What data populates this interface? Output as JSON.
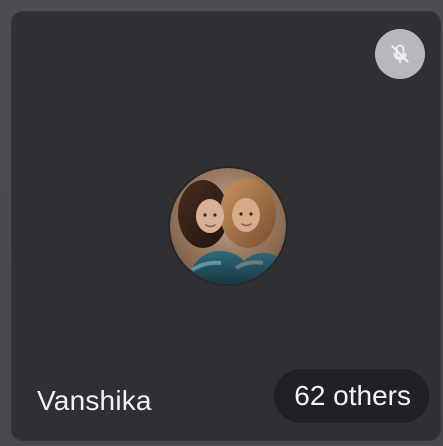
{
  "tile": {
    "name": "Vanshika",
    "others_label": "62 others",
    "muted": true,
    "icons": {
      "mute": "mic-off-icon"
    },
    "colors": {
      "tile_background": "#2e3034",
      "outer_background": "#4a4c50",
      "badge_background": "#b7b8bc",
      "pill_background": "#1f2124",
      "text": "#f1f2f4"
    }
  }
}
